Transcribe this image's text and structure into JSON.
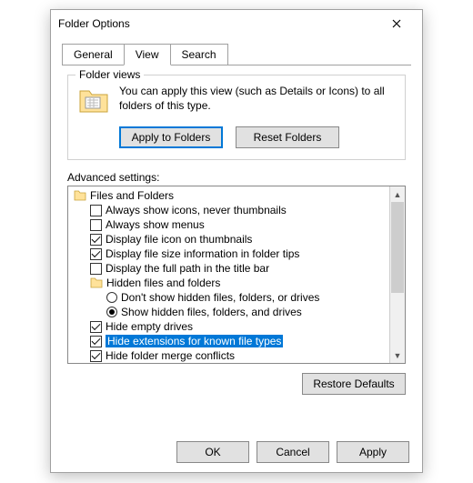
{
  "window": {
    "title": "Folder Options"
  },
  "tabs": {
    "general": "General",
    "view": "View",
    "search": "Search"
  },
  "folder_views": {
    "group_label": "Folder views",
    "description": "You can apply this view (such as Details or Icons) to all folders of this type.",
    "apply_button": "Apply to Folders",
    "reset_button": "Reset Folders"
  },
  "advanced": {
    "label": "Advanced settings:",
    "tree": {
      "root": "Files and Folders",
      "items": [
        {
          "label": "Always show icons, never thumbnails",
          "checked": false
        },
        {
          "label": "Always show menus",
          "checked": false
        },
        {
          "label": "Display file icon on thumbnails",
          "checked": true
        },
        {
          "label": "Display file size information in folder tips",
          "checked": true
        },
        {
          "label": "Display the full path in the title bar",
          "checked": false
        }
      ],
      "hidden_group": "Hidden files and folders",
      "radios": [
        {
          "label": "Don't show hidden files, folders, or drives",
          "checked": false
        },
        {
          "label": "Show hidden files, folders, and drives",
          "checked": true
        }
      ],
      "items2": [
        {
          "label": "Hide empty drives",
          "checked": true
        },
        {
          "label": "Hide extensions for known file types",
          "checked": true,
          "selected": true
        },
        {
          "label": "Hide folder merge conflicts",
          "checked": true
        }
      ]
    },
    "restore_button": "Restore Defaults"
  },
  "footer": {
    "ok": "OK",
    "cancel": "Cancel",
    "apply": "Apply"
  }
}
